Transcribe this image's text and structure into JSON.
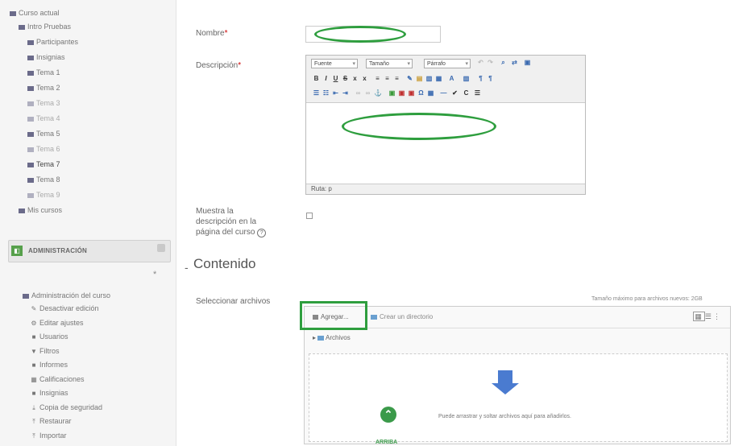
{
  "sidebar": {
    "course_tree": [
      {
        "label": "Curso actual",
        "style": "normal"
      },
      {
        "label": "Intro Pruebas",
        "style": "normal"
      },
      {
        "label": "Participantes",
        "style": "normal"
      },
      {
        "label": "Insignias",
        "style": "normal"
      },
      {
        "label": "Tema 1",
        "style": "normal"
      },
      {
        "label": "Tema 2",
        "style": "normal"
      },
      {
        "label": "Tema 3",
        "style": "dim"
      },
      {
        "label": "Tema 4",
        "style": "dim"
      },
      {
        "label": "Tema 5",
        "style": "normal"
      },
      {
        "label": "Tema 6",
        "style": "dim"
      },
      {
        "label": "Tema 7",
        "style": "bold"
      },
      {
        "label": "Tema 8",
        "style": "normal"
      },
      {
        "label": "Tema 9",
        "style": "dim"
      },
      {
        "label": "Mis cursos",
        "style": "normal"
      }
    ],
    "admin_block": {
      "title": "ADMINISTRACIÓN",
      "collapse_marker": "*",
      "heading": "Administración del curso",
      "items": [
        {
          "label": "Desactivar edición",
          "icon": "pencil-icon",
          "glyph": "✎"
        },
        {
          "label": "Editar ajustes",
          "icon": "gear-icon",
          "glyph": "⚙"
        },
        {
          "label": "Usuarios",
          "icon": "folder-icon",
          "glyph": "■"
        },
        {
          "label": "Filtros",
          "icon": "filter-icon",
          "glyph": "▼"
        },
        {
          "label": "Informes",
          "icon": "folder-icon",
          "glyph": "■"
        },
        {
          "label": "Calificaciones",
          "icon": "grid-icon",
          "glyph": "▦"
        },
        {
          "label": "Insignias",
          "icon": "folder-icon",
          "glyph": "■"
        },
        {
          "label": "Copia de seguridad",
          "icon": "backup-icon",
          "glyph": "⤓"
        },
        {
          "label": "Restaurar",
          "icon": "restore-icon",
          "glyph": "⤒"
        },
        {
          "label": "Importar",
          "icon": "import-icon",
          "glyph": "⤒"
        }
      ]
    }
  },
  "form": {
    "name_label": "Nombre",
    "name_required": "*",
    "name_value": "",
    "description_label": "Descripción",
    "description_required": "*",
    "editor": {
      "font_select": "Fuente",
      "size_select": "Tamaño",
      "format_select": "Párrafo",
      "path": "Ruta: p"
    },
    "show_description_label": "Muestra la descripción en la página del curso",
    "help_icon_glyph": "?",
    "section_toggle": "-",
    "section_title": "Contenido",
    "select_files_label": "Seleccionar archivos",
    "max_size": "Tamaño máximo para archivos nuevos: 2GB",
    "filepicker": {
      "add_label": "Agregar...",
      "create_folder_label": "Crear un directorio",
      "path_label": "Archivos",
      "drop_text": "Puede arrastrar y soltar archivos aquí para añadirlos."
    },
    "back_to_top_label": "ARRIBA"
  },
  "colors": {
    "highlight": "#2e9e3e",
    "drop_arrow": "#4a7bd0"
  }
}
